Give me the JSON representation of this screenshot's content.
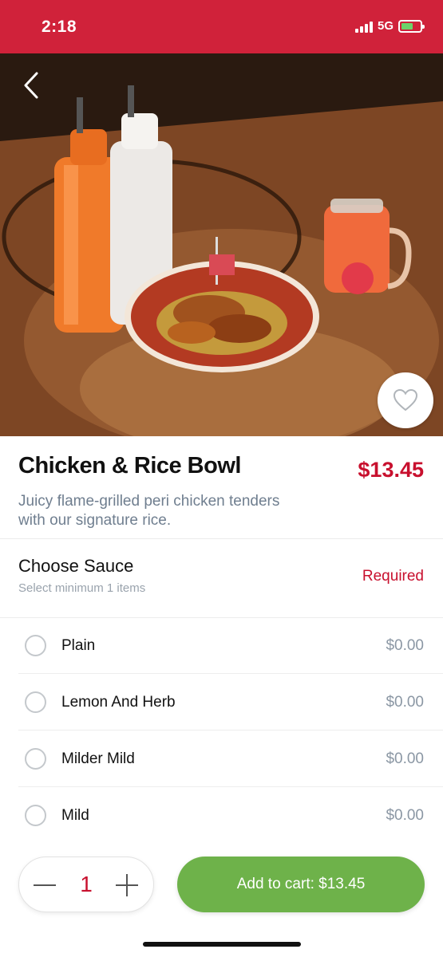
{
  "status_bar": {
    "time": "2:18",
    "network": "5G",
    "background_color": "#d0223a"
  },
  "hero": {
    "back_icon": "chevron-left-icon",
    "favorite_icon": "heart-icon"
  },
  "item": {
    "title": "Chicken & Rice Bowl",
    "price": "$13.45",
    "description": "Juicy flame-grilled peri chicken tenders with our signature rice."
  },
  "sauce_section": {
    "title": "Choose Sauce",
    "subtitle": "Select minimum 1 items",
    "requirement": "Required",
    "options": [
      {
        "label": "Plain",
        "price": "$0.00"
      },
      {
        "label": "Lemon And Herb",
        "price": "$0.00"
      },
      {
        "label": "Milder Mild",
        "price": "$0.00"
      },
      {
        "label": "Mild",
        "price": "$0.00"
      }
    ]
  },
  "cart_bar": {
    "quantity": "1",
    "add_to_cart_label": "Add to cart: $13.45"
  },
  "colors": {
    "brand_red": "#c8102e",
    "add_button_green": "#6eb24a",
    "muted_text": "#6f7e8f"
  }
}
